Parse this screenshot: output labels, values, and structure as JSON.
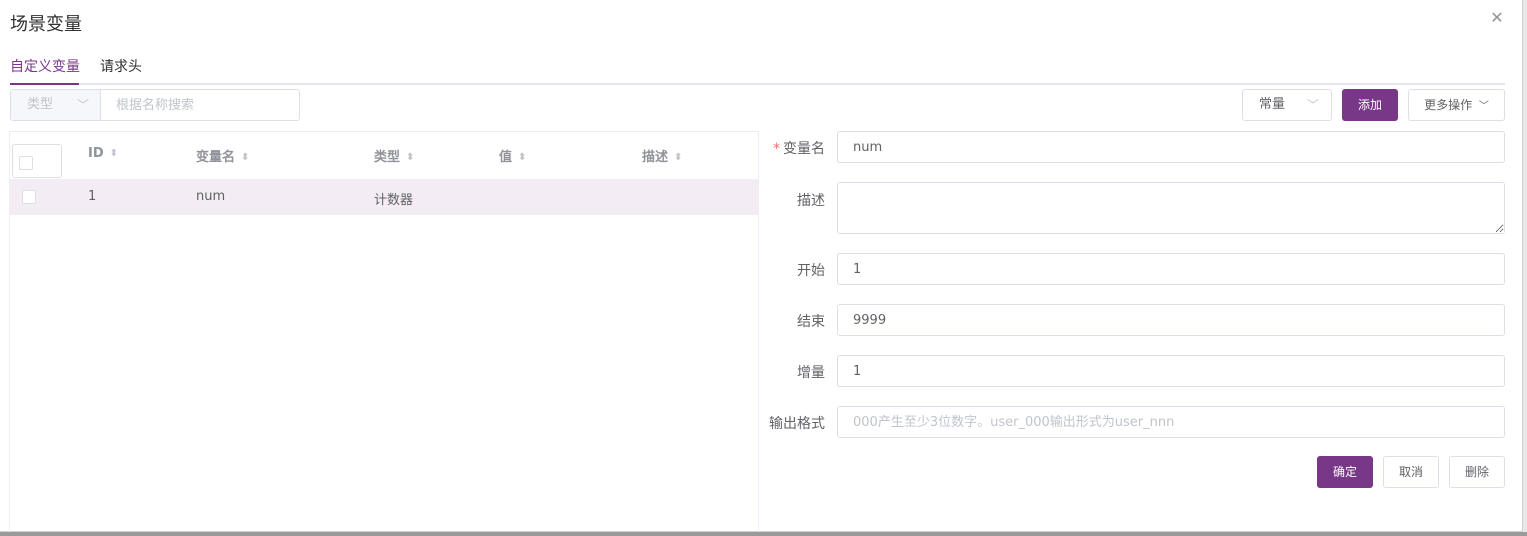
{
  "dialog": {
    "title": "场景变量"
  },
  "tabs": [
    {
      "label": "自定义变量",
      "active": true
    },
    {
      "label": "请求头",
      "active": false
    }
  ],
  "toolbar": {
    "type_filter_placeholder": "类型",
    "search_placeholder": "根据名称搜索",
    "variable_kind_selected": "常量",
    "add_label": "添加",
    "more_label": "更多操作"
  },
  "table": {
    "columns": [
      "ID",
      "变量名",
      "类型",
      "值",
      "描述"
    ],
    "rows": [
      {
        "id": "1",
        "name": "num",
        "type": "计数器",
        "value": "",
        "description": ""
      }
    ]
  },
  "form": {
    "name_label": "变量名",
    "name_value": "num",
    "description_label": "描述",
    "description_value": "",
    "start_label": "开始",
    "start_value": "1",
    "end_label": "结束",
    "end_value": "9999",
    "step_label": "增量",
    "step_value": "1",
    "format_label": "输出格式",
    "format_placeholder": "000产生至少3位数字。user_000输出形式为user_nnn",
    "confirm_label": "确定",
    "cancel_label": "取消",
    "delete_label": "删除"
  },
  "colors": {
    "accent": "#783887",
    "row_highlight": "#f3ecf4",
    "required": "#f56c6c"
  },
  "icons": {
    "close": "close-icon",
    "chevron": "chevron-down-icon",
    "sort": "sort-icon"
  }
}
